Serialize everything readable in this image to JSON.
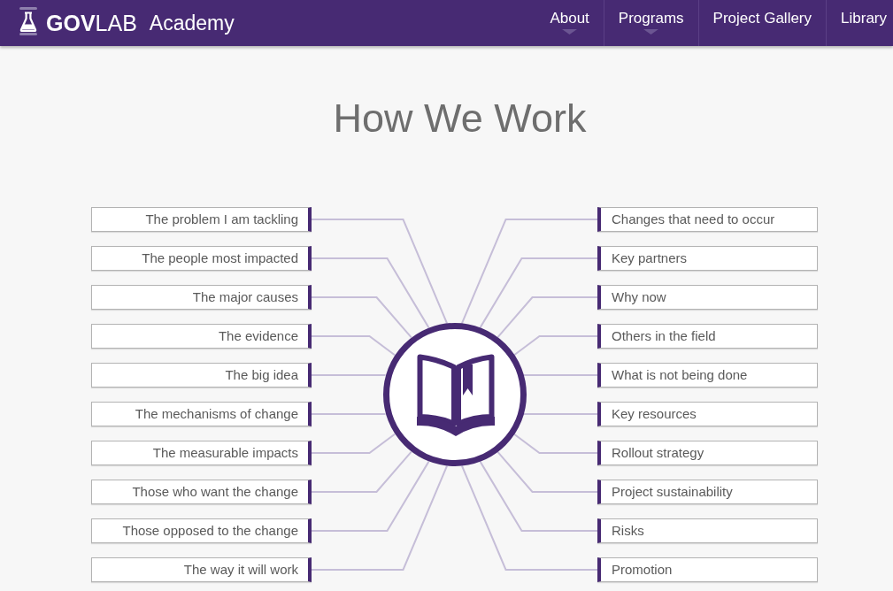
{
  "header": {
    "logo": "**GOV**LAB",
    "subtitle": "Academy",
    "nav": [
      {
        "label": "About",
        "dropdown": true
      },
      {
        "label": "Programs",
        "dropdown": true
      },
      {
        "label": "Project Gallery",
        "dropdown": false
      },
      {
        "label": "Library",
        "dropdown": false
      }
    ]
  },
  "title": "How We Work",
  "diagram": {
    "left": [
      "The problem I am tackling",
      "The people most impacted",
      "The major causes",
      "The evidence",
      "The big idea",
      "The mechanisms of change",
      "The measurable impacts",
      "Those who want the change",
      "Those opposed to the change",
      "The way it will work"
    ],
    "right": [
      "Changes that need to occur",
      "Key partners",
      "Why now",
      "Others in the field",
      "What is not being done",
      "Key resources",
      "Rollout strategy",
      "Project sustainability",
      "Risks",
      "Promotion"
    ]
  }
}
